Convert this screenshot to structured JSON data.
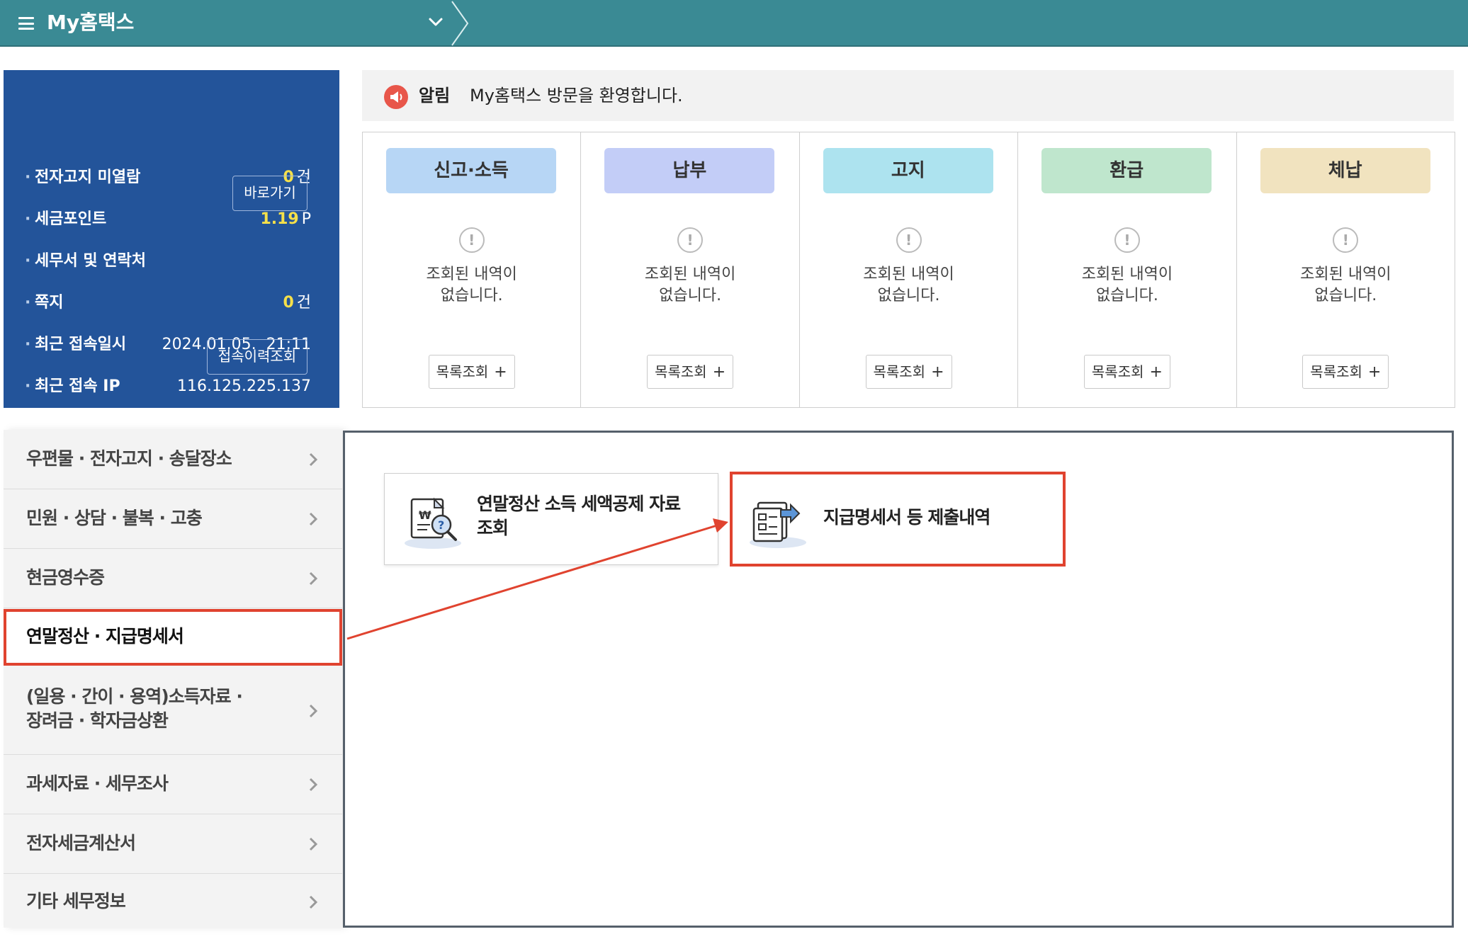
{
  "header": {
    "title": "My홈택스"
  },
  "info_panel": {
    "rows": [
      {
        "label": "전자고지 미열람",
        "value": "0",
        "unit": "건"
      },
      {
        "label": "세금포인트",
        "value": "1.19",
        "unit": "P"
      },
      {
        "label": "세무서 및 연락처",
        "button": "바로가기"
      },
      {
        "label": "쪽지",
        "value": "0",
        "unit": "건"
      },
      {
        "label": "최근 접속일시",
        "value": "2024.01.05.  21:11"
      },
      {
        "label": "최근 접속 IP",
        "value": "116.125.225.137"
      }
    ],
    "history_button": "접속이력조회"
  },
  "notice": {
    "tag": "알림",
    "message": "My홈택스 방문을 환영합니다."
  },
  "cards": [
    {
      "title": "신고·소득",
      "color": "#b7d6f5",
      "empty": "조회된 내역이\n없습니다.",
      "button": "목록조회"
    },
    {
      "title": "납부",
      "color": "#c3cdf7",
      "empty": "조회된 내역이\n없습니다.",
      "button": "목록조회"
    },
    {
      "title": "고지",
      "color": "#ade3ef",
      "empty": "조회된 내역이\n없습니다.",
      "button": "목록조회"
    },
    {
      "title": "환급",
      "color": "#bfe6cd",
      "empty": "조회된 내역이\n없습니다.",
      "button": "목록조회"
    },
    {
      "title": "체납",
      "color": "#f1e3bf",
      "empty": "조회된 내역이\n없습니다.",
      "button": "목록조회"
    }
  ],
  "menu": {
    "items": [
      {
        "label": "우편물 · 전자고지 · 송달장소"
      },
      {
        "label": "민원 · 상담 · 불복 · 고충"
      },
      {
        "label": "현금영수증"
      },
      {
        "label": "연말정산 · 지급명세서",
        "active": true
      },
      {
        "label": "(일용 · 간이 · 용역)소득자료 ·\n장려금 · 학자금상환"
      },
      {
        "label": "과세자료 · 세무조사"
      },
      {
        "label": "전자세금계산서"
      },
      {
        "label": "기타 세무정보"
      }
    ]
  },
  "tiles": [
    {
      "label": "연말정산 소득 세액공제 자료\n조회",
      "icon": "tax-search-icon"
    },
    {
      "label": "지급명세서 등 제출내역",
      "icon": "document-submit-icon"
    }
  ],
  "colors": {
    "header_bg": "#3a8a94",
    "panel_bg": "#23549a",
    "highlight": "#e0432f",
    "point": "#f5e04a"
  }
}
